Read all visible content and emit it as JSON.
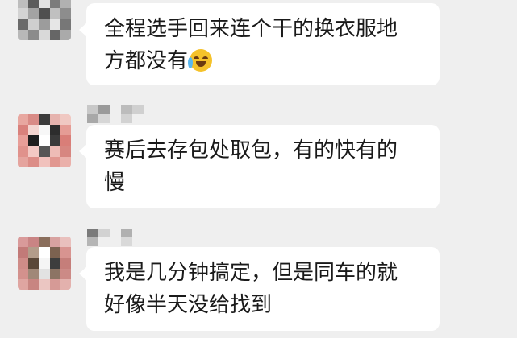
{
  "messages": [
    {
      "text_line1": "全程选手回来连个干的换衣服地",
      "text_line2": "方都没有",
      "emoji": "laughing-crying-emoji"
    },
    {
      "text_line1": "赛后去存包处取包，有的快有的",
      "text_line2": "慢"
    },
    {
      "text_line1": "我是几分钟搞定，但是同车的就",
      "text_line2": "好像半天没给找到"
    }
  ]
}
